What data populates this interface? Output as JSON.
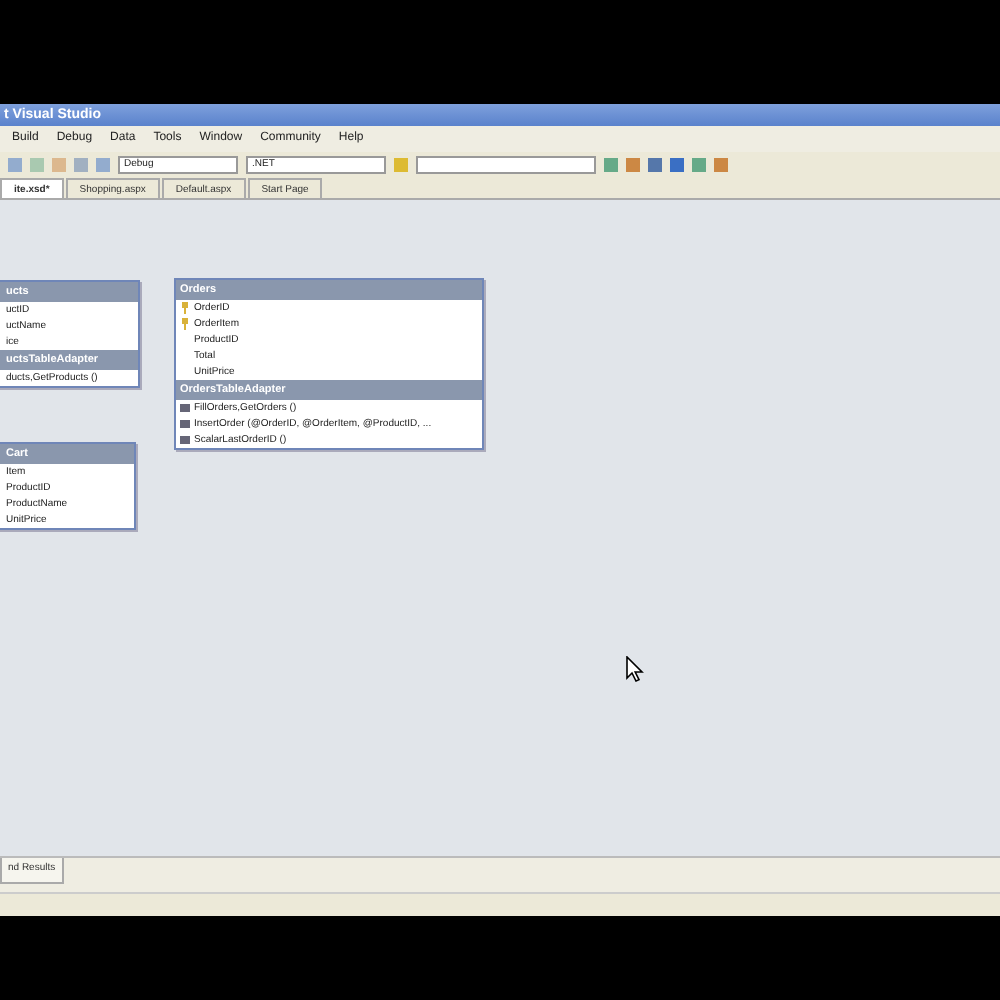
{
  "title_bar": {
    "title": "t Visual Studio"
  },
  "menu": [
    "Build",
    "Debug",
    "Data",
    "Tools",
    "Window",
    "Community",
    "Help"
  ],
  "toolbar": {
    "combos": [
      "Debug",
      ".NET"
    ]
  },
  "tabs": [
    {
      "label": "ite.xsd*",
      "selected": true
    },
    {
      "label": "Shopping.aspx",
      "selected": false
    },
    {
      "label": "Default.aspx",
      "selected": false
    },
    {
      "label": "Start Page",
      "selected": false
    }
  ],
  "tables": [
    {
      "name": "ucts",
      "columns": [
        {
          "name": "uctID",
          "key": false
        },
        {
          "name": "uctName",
          "key": false
        },
        {
          "name": "ice",
          "key": false
        }
      ],
      "adapter": {
        "name": "uctsTableAdapter",
        "methods": [
          "ducts,GetProducts ()"
        ]
      }
    },
    {
      "name": "Orders",
      "columns": [
        {
          "name": "OrderID",
          "key": true
        },
        {
          "name": "OrderItem",
          "key": true
        },
        {
          "name": "ProductID",
          "key": false
        },
        {
          "name": "Total",
          "key": false
        },
        {
          "name": "UnitPrice",
          "key": false
        }
      ],
      "adapter": {
        "name": "OrdersTableAdapter",
        "methods": [
          "FillOrders,GetOrders ()",
          "InsertOrder (@OrderID, @OrderItem, @ProductID, ...",
          "ScalarLastOrderID ()"
        ]
      }
    },
    {
      "name": "Cart",
      "columns": [
        {
          "name": "Item",
          "key": false
        },
        {
          "name": "ProductID",
          "key": false
        },
        {
          "name": "ProductName",
          "key": false
        },
        {
          "name": "UnitPrice",
          "key": false
        }
      ]
    }
  ],
  "bottom_tabs": [
    "nd Results"
  ]
}
